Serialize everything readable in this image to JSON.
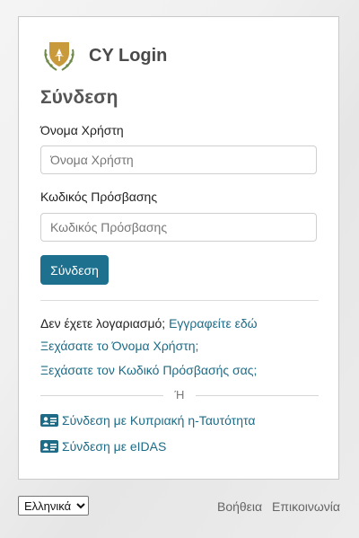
{
  "brand": {
    "title": "CY Login",
    "logo_icon": "cyprus-coat-of-arms-icon"
  },
  "form": {
    "heading": "Σύνδεση",
    "username": {
      "label": "Όνομα Χρήστη",
      "placeholder": "Όνομα Χρήστη",
      "value": ""
    },
    "password": {
      "label": "Κωδικός Πρόσβασης",
      "placeholder": "Κωδικός Πρόσβασης",
      "value": ""
    },
    "submit_label": "Σύνδεση"
  },
  "links": {
    "no_account_text": "Δεν έχετε λογαριασμό;",
    "register": "Εγγραφείτε εδώ",
    "forgot_username": "Ξεχάσατε το Όνομα Χρήστη;",
    "forgot_password": "Ξεχάσατε τον Κωδικό Πρόσβασής σας;"
  },
  "separator": {
    "text": "Ή"
  },
  "alt_logins": [
    {
      "label": "Σύνδεση με Κυπριακή η-Ταυτότητα",
      "icon": "id-card-icon"
    },
    {
      "label": "Σύνδεση με eIDAS",
      "icon": "id-card-icon"
    }
  ],
  "footer": {
    "language": {
      "selected": "Ελληνικά",
      "options": [
        "Ελληνικά"
      ]
    },
    "help": "Βοήθεια",
    "contact": "Επικοινωνία"
  },
  "colors": {
    "accent": "#1d718e",
    "link": "#1d6b86",
    "logo_gold": "#c99a3b"
  }
}
